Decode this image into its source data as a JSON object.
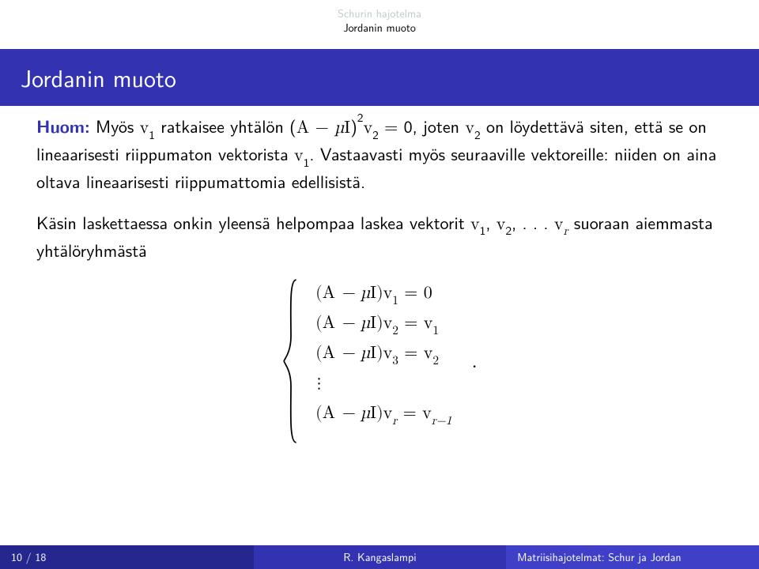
{
  "nav": {
    "section_dim": "Schurin hajotelma",
    "section_cur": "Jordanin muoto"
  },
  "title": "Jordanin muoto",
  "p1": {
    "lead": "Huom:",
    "t1": " Myös ",
    "v1": "v",
    "sub1": "1",
    "t2": " ratkaisee yhtälön (",
    "A": "A",
    "minus": " − ",
    "mu": "µ",
    "I": "I",
    "t3": ")",
    "sup2": "2",
    "v2": "v",
    "sub2": "2",
    "eq0": " = 0, joten ",
    "v2b": "v",
    "sub2b": "2",
    "t4": " on löydettävä siten, että se on lineaarisesti riippumaton vektorista ",
    "v1b": "v",
    "sub1b": "1",
    "t5": ". Vastaavasti myös seuraaville vektoreille: niiden on aina oltava lineaarisesti riippumattomia edellisistä."
  },
  "p2": {
    "t1": "Käsin laskettaessa onkin yleensä helpompaa laskea vektorit ",
    "v1": "v",
    "s1": "1",
    "c": ", ",
    "v2": "v",
    "s2": "2",
    "c2": ", . . . ",
    "vr": "v",
    "sr": "r",
    "t2": " suoraan aiemmasta yhtälöryhmästä"
  },
  "eqs": {
    "l1a": "(",
    "A1": "A",
    "m1": " − µ",
    "I1": "I",
    "r1": ")",
    "v1": "v",
    "s1": "1",
    "eq1": " = 0",
    "l2a": "(",
    "A2": "A",
    "m2": " − µ",
    "I2": "I",
    "r2": ")",
    "v2": "v",
    "s2": "2",
    "eq2": " = ",
    "rv1": "v",
    "rs1": "1",
    "l3a": "(",
    "A3": "A",
    "m3": " − µ",
    "I3": "I",
    "r3": ")",
    "v3": "v",
    "s3": "3",
    "eq3": " = ",
    "rv2": "v",
    "rs2": "2",
    "dots": "⋮",
    "l4a": "(",
    "A4": "A",
    "m4": " − µ",
    "I4": "I",
    "r4": ")",
    "v4": "v",
    "s4": "r",
    "eq4": " = ",
    "rv3": "v",
    "rs3": "r−1",
    "period": "."
  },
  "footer": {
    "page": "10 / 18",
    "author": "R. Kangaslampi",
    "title": "Matriisihajotelmat: Schur ja Jordan"
  }
}
